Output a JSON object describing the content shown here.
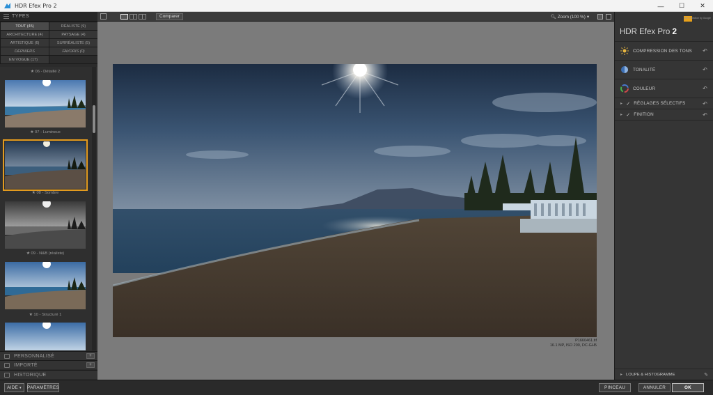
{
  "window": {
    "title": "HDR Efex Pro 2",
    "min": "—",
    "max": "☐",
    "close": "✕"
  },
  "left": {
    "types_header": "TYPES",
    "categories": [
      {
        "label": "TOUT (45)",
        "selected": true
      },
      {
        "label": "RÉALISTE (9)"
      },
      {
        "label": "ARCHITECTURE (4)"
      },
      {
        "label": "PAYSAGE (4)"
      },
      {
        "label": "ARTISTIQUE (6)"
      },
      {
        "label": "SURRÉALISTE (5)"
      },
      {
        "label": "DERNIERS",
        "italic": true
      },
      {
        "label": "FAVORIS (0)",
        "italic": true
      },
      {
        "label": "EN VOGUE (17)"
      }
    ],
    "thumbnails": [
      {
        "label": "★ 06 - Détaillé 2"
      },
      {
        "label": "★ 07 - Lumineux"
      },
      {
        "label": "★ 08 - Sombre",
        "selected": true
      },
      {
        "label": "★ 09 - N&B (réaliste)"
      },
      {
        "label": "★ 10 - Structuré 1"
      }
    ],
    "sections": [
      {
        "label": "PERSONNALISÉ",
        "btn": "+"
      },
      {
        "label": "IMPORTÉ",
        "btn": "+"
      },
      {
        "label": "HISTORIQUE"
      }
    ]
  },
  "toolbar": {
    "compare": "Comparer",
    "zoom": "Zoom (100 %)"
  },
  "photo_meta": {
    "filename": "P1660461.tif",
    "info": "16.1 MP, ISO 200, DC-GH5"
  },
  "right": {
    "brand": "HDR Efex Pro",
    "brand_version": "2",
    "google_text": "Nik Collection by Google",
    "rows": [
      {
        "label": "COMPRESSION DES TONS"
      },
      {
        "label": "TONALITÉ"
      },
      {
        "label": "COULEUR"
      },
      {
        "label": "RÉGLAGES SÉLECTIFS"
      },
      {
        "label": "FINITION"
      }
    ],
    "loupe": "LOUPE & HISTOGRAMME",
    "reset_glyph": "↶"
  },
  "bottom": {
    "help": "AIDE",
    "settings": "PARAMÈTRES",
    "brush": "PINCEAU",
    "cancel": "ANNULER",
    "ok": "OK"
  },
  "colors": {
    "selection_accent": "#e39b1f",
    "canvas_bg": "#7b7b7b",
    "panel_bg": "#353535"
  }
}
